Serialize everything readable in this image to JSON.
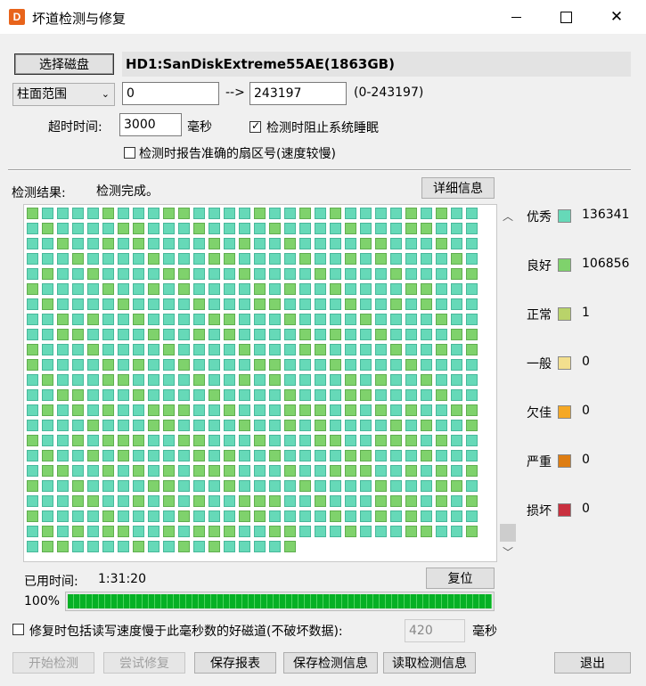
{
  "window": {
    "title": "坏道检测与修复",
    "app_icon_letter": "D"
  },
  "disk": {
    "select_button": "选择磁盘",
    "name": "HD1:SanDiskExtreme55AE(1863GB)"
  },
  "range": {
    "mode": "柱面范围",
    "start": "0",
    "arrow": "-->",
    "end": "243197",
    "hint": "(0-243197)"
  },
  "timeout": {
    "label": "超时时间:",
    "value": "3000",
    "unit": "毫秒"
  },
  "options": {
    "prevent_sleep": {
      "label": "检测时阻止系统睡眠",
      "checked": true
    },
    "report_sector": {
      "label": "检测时报告准确的扇区号(速度较慢)",
      "checked": false
    }
  },
  "result": {
    "label": "检测结果:",
    "status": "检测完成。",
    "details_button": "详细信息"
  },
  "legend": [
    {
      "label": "优秀",
      "color": "#66d9b8",
      "count": "136341"
    },
    {
      "label": "良好",
      "color": "#7fd26c",
      "count": "106856"
    },
    {
      "label": "正常",
      "color": "#b9d36a",
      "count": "1"
    },
    {
      "label": "一般",
      "color": "#f3df8e",
      "count": "0"
    },
    {
      "label": "欠佳",
      "color": "#f5a825",
      "count": "0"
    },
    {
      "label": "严重",
      "color": "#de7d12",
      "count": "0"
    },
    {
      "label": "损坏",
      "color": "#c9303f",
      "count": "0"
    }
  ],
  "elapsed": {
    "label": "已用时间:",
    "value": "1:31:20",
    "reset_button": "复位"
  },
  "progress": {
    "label": "100%",
    "value": 1.0
  },
  "repair_option": {
    "label": "修复时包括读写速度慢于此毫秒数的好磁道(不破坏数据):",
    "value": "420",
    "unit": "毫秒",
    "checked": false
  },
  "buttons": {
    "start": "开始检测",
    "try_repair": "尝试修复",
    "save_report": "保存报表",
    "save_info": "保存检测信息",
    "load_info": "读取检测信息",
    "exit": "退出"
  },
  "scroll_icons": {
    "up": "chevron-up-icon",
    "down": "chevron-down-icon"
  }
}
